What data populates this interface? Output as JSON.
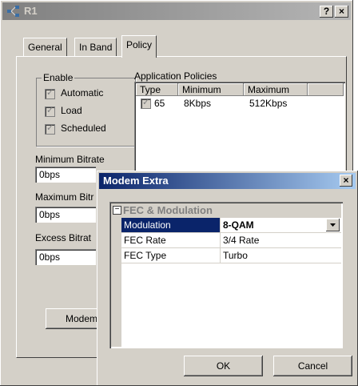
{
  "window": {
    "title": "R1",
    "help_button": "?",
    "close_button": "×"
  },
  "tabs": [
    {
      "label": "General"
    },
    {
      "label": "In Band"
    },
    {
      "label": "Policy"
    }
  ],
  "enable_group": {
    "label": "Enable",
    "items": [
      {
        "label": "Automatic",
        "checked": true
      },
      {
        "label": "Load",
        "checked": true
      },
      {
        "label": "Scheduled",
        "checked": true
      }
    ]
  },
  "app_policies": {
    "label": "Application Policies",
    "columns": [
      "Type",
      "Minimum",
      "Maximum"
    ],
    "rows": [
      {
        "type": "65",
        "minimum": "8Kbps",
        "maximum": "512Kbps",
        "checked": true
      }
    ]
  },
  "fields": {
    "minimum_bitrate": {
      "label": "Minimum Bitrate",
      "value": "0bps"
    },
    "maximum_bitrate": {
      "label": "Maximum Bitr",
      "value": "0bps"
    },
    "excess_bitrate": {
      "label": "Excess Bitrat",
      "value": "0bps"
    }
  },
  "modem_button": "Modem",
  "dialog": {
    "title": "Modem Extra",
    "close_button": "×",
    "category": "FEC & Modulation",
    "properties": [
      {
        "name": "Modulation",
        "value": "8-QAM"
      },
      {
        "name": "FEC Rate",
        "value": "3/4 Rate"
      },
      {
        "name": "FEC Type",
        "value": "Turbo"
      }
    ],
    "ok_label": "OK",
    "cancel_label": "Cancel"
  }
}
